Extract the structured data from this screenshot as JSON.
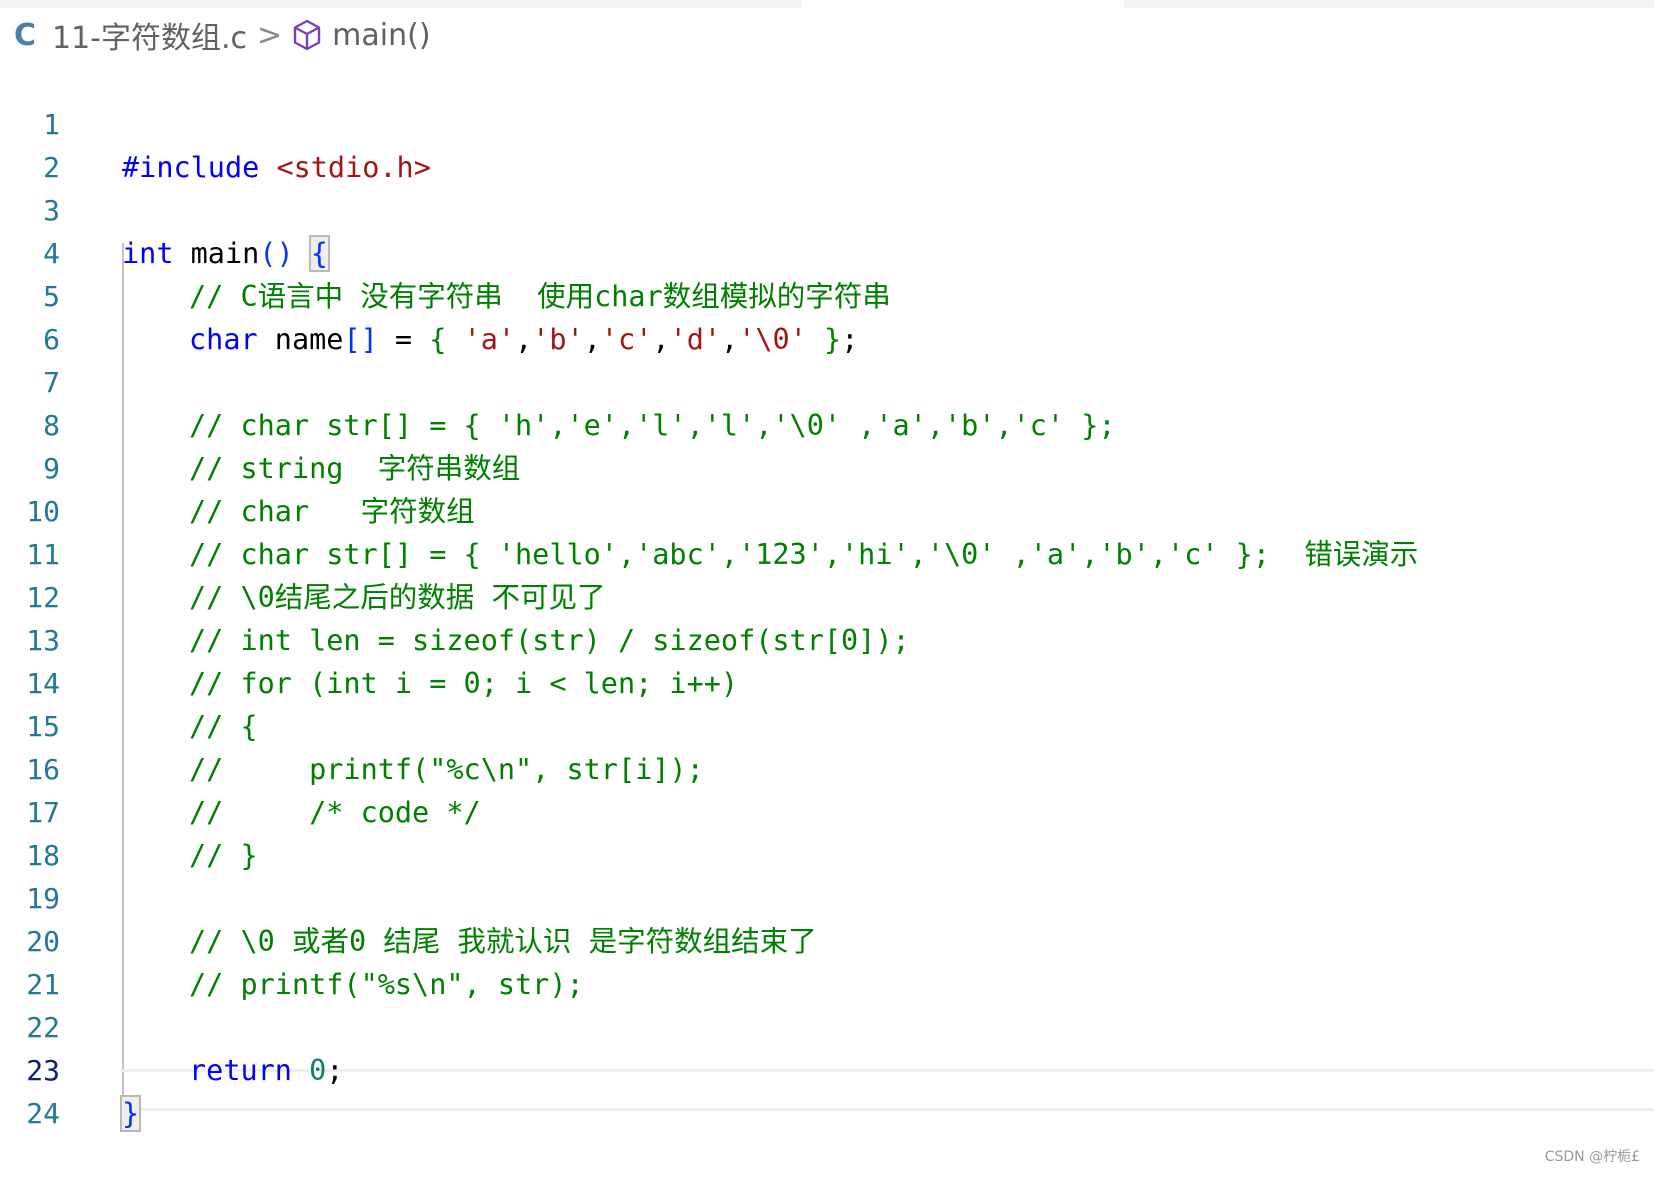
{
  "breadcrumb": {
    "file_icon": "C",
    "file_name": "11-字符数组.c",
    "separator": ">",
    "symbol_icon": "cube-icon",
    "symbol_name": "main()"
  },
  "editor": {
    "active_line": 23,
    "line_numbers": [
      "1",
      "2",
      "3",
      "4",
      "5",
      "6",
      "7",
      "8",
      "9",
      "10",
      "11",
      "12",
      "13",
      "14",
      "15",
      "16",
      "17",
      "18",
      "19",
      "20",
      "21",
      "22",
      "23",
      "24"
    ],
    "lines": {
      "l1_kw": "#include",
      "l1_str": "<stdio.h>",
      "l3_kw": "int",
      "l3_name": " main",
      "l3_paren": "()",
      "l3_brace": "{",
      "l4": "// C语言中 没有字符串  使用char数组模拟的字符串",
      "l5_kw": "char",
      "l5_name": " name",
      "l5_brk": "[]",
      "l5_eq": " = ",
      "l5_ob": "{",
      "l5_a": "'a'",
      "l5_b": "'b'",
      "l5_c": "'c'",
      "l5_d": "'d'",
      "l5_z": "'\\0'",
      "l5_cb": "}",
      "l5_semi": ";",
      "l7": "// char str[] = { 'h','e','l','l','\\0' ,'a','b','c' };",
      "l8": "// string  字符串数组",
      "l9": "// char   字符数组",
      "l10": "// char str[] = { 'hello','abc','123','hi','\\0' ,'a','b','c' };  错误演示",
      "l11": "// \\0结尾之后的数据 不可见了",
      "l12": "// int len = sizeof(str) / sizeof(str[0]);",
      "l13": "// for (int i = 0; i < len; i++)",
      "l14": "// {",
      "l15": "//     printf(\"%c\\n\", str[i]);",
      "l16": "//     /* code */",
      "l17": "// }",
      "l19": "// \\0 或者0 结尾 我就认识 是字符数组结束了",
      "l20": "// printf(\"%s\\n\", str);",
      "l22_kw": "return",
      "l22_num": "0",
      "l22_semi": ";",
      "l23_brace": "}"
    }
  },
  "footer": {
    "watermark": "CSDN @柠栀£"
  }
}
